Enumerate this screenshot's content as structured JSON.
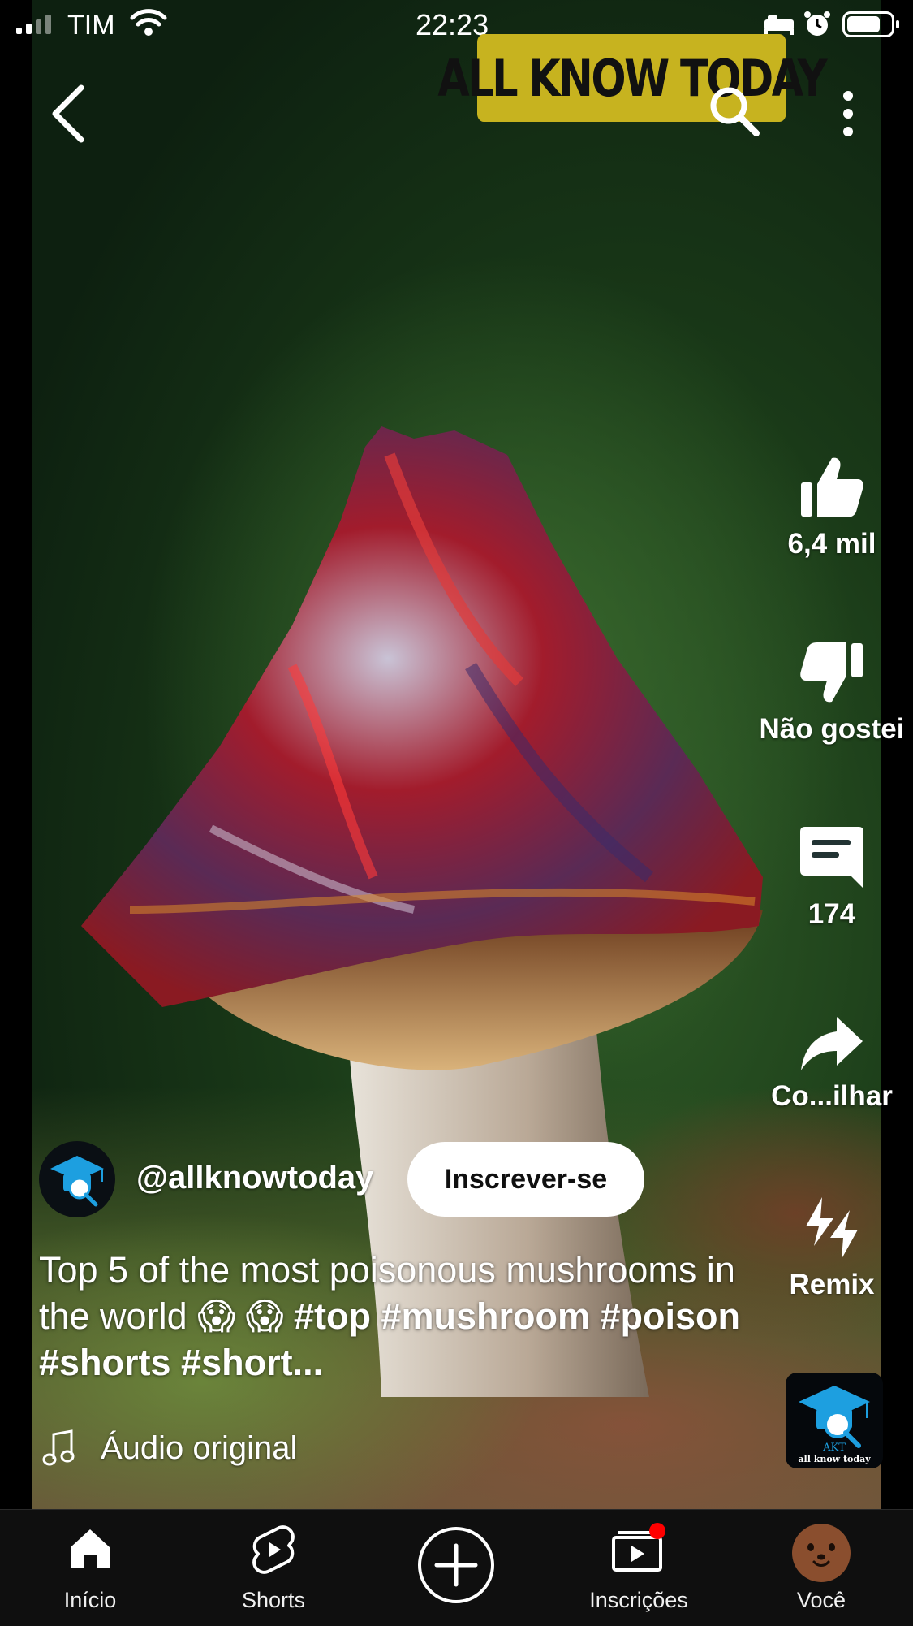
{
  "status_bar": {
    "carrier": "TIM",
    "time": "22:23",
    "icons": [
      "signal-icon",
      "wifi-icon",
      "bed-icon",
      "alarm-icon",
      "battery-icon"
    ]
  },
  "header": {
    "banner_text": "ALL KNOW TODAY",
    "icons": [
      "back-arrow-icon",
      "search-icon",
      "more-vert-icon"
    ]
  },
  "actions": {
    "like_count": "6,4 mil",
    "dislike_label": "Não gostei",
    "comment_count": "174",
    "share_label": "Co...ilhar",
    "remix_label": "Remix"
  },
  "channel": {
    "handle": "@allknowtoday",
    "subscribe_label": "Inscrever-se",
    "logo_text": "AKT",
    "logo_subtext": "all know today"
  },
  "video": {
    "title_plain": "Top 5 of the most poisonous mushrooms in the world 😱 😱 ",
    "title_tags": "#top #mushroom #poison #shorts #short...",
    "audio_label": "Áudio original"
  },
  "bottom_nav": {
    "items": [
      {
        "label": "Início",
        "icon": "home-icon"
      },
      {
        "label": "Shorts",
        "icon": "shorts-icon"
      },
      {
        "label": "",
        "icon": "create-plus-icon"
      },
      {
        "label": "Inscrições",
        "icon": "subscriptions-icon"
      },
      {
        "label": "Você",
        "icon": "profile-avatar"
      }
    ]
  },
  "colors": {
    "banner": "#c7b31f",
    "notification_dot": "#ff0000",
    "nav_background": "#0f0f0f",
    "subscribe_button": "#ffffff"
  }
}
